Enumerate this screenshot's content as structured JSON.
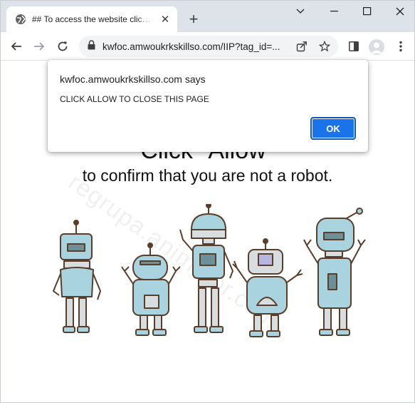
{
  "browser": {
    "tab_title": "## To access the website click the",
    "new_tab_symbol": "+",
    "url": "kwfoc.amwoukrkskillso.com/IIP?tag_id=...",
    "icons": [
      "globe-icon",
      "close-icon",
      "chevron-down-icon",
      "minimize-icon",
      "maximize-icon",
      "window-close-icon",
      "back-arrow-icon",
      "forward-arrow-icon",
      "reload-icon",
      "lock-icon",
      "share-icon",
      "star-icon",
      "side-panel-icon",
      "profile-icon",
      "more-menu-icon"
    ]
  },
  "page": {
    "headline": "Click \"Allow\"",
    "subline": "to confirm that you are not a robot.",
    "watermark": "regrupa.animator.com"
  },
  "dialog": {
    "title": "kwfoc.amwoukrkskillso.com says",
    "message": "CLICK ALLOW TO CLOSE THIS PAGE",
    "ok_label": "OK"
  },
  "colors": {
    "accent": "#1a73e8",
    "titlebar": "#dee3ea",
    "robot_fill": "#a9d3df",
    "robot_stroke": "#5a3e2b"
  }
}
